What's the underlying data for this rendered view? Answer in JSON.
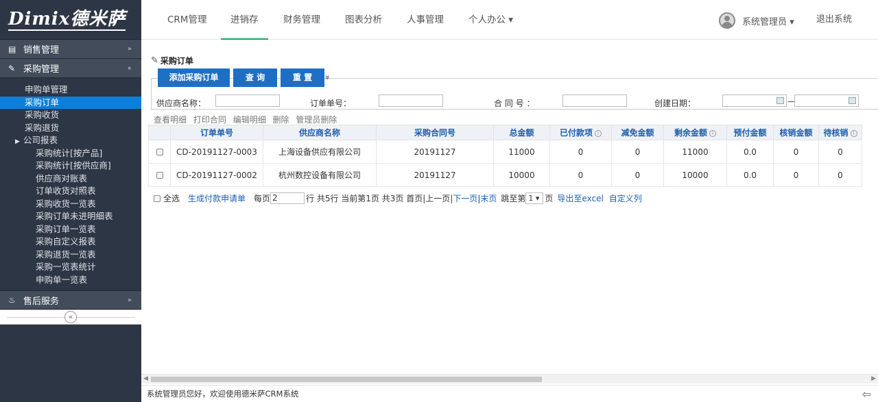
{
  "logo": "Dimix德米萨",
  "sidebar": {
    "sales": "销售管理",
    "purchase": "采购管理",
    "items": [
      "申购单管理",
      "采购订单",
      "采购收货",
      "采购退货"
    ],
    "report_group": "公司报表",
    "report_items": [
      "采购统计[按产品]",
      "采购统计[按供应商]",
      "供应商对账表",
      "订单收货对照表",
      "采购收货一览表",
      "采购订单未进明细表",
      "采购订单一览表",
      "采购自定义报表",
      "采购退货一览表",
      "采购一览表统计",
      "申购单一览表"
    ],
    "after_sales": "售后服务",
    "collapse": "«"
  },
  "topnav": {
    "items": [
      "CRM管理",
      "进销存",
      "财务管理",
      "图表分析",
      "人事管理",
      "个人办公 ▾"
    ],
    "user": "系统管理员 ▾",
    "logout": "退出系统"
  },
  "page": {
    "title": "采购订单",
    "btn_add": "添加采购订单",
    "btn_query": "查 询",
    "btn_reset": "重 置",
    "more": "»"
  },
  "search": {
    "supplier": "供应商名称：",
    "order_no": "订单单号：",
    "contract": "合 同 号 ：",
    "created": "创建日期：",
    "dash": "—"
  },
  "actions": [
    "查看明细",
    "打印合同",
    "编辑明细",
    "删除",
    "管理员删除"
  ],
  "table": {
    "headers": [
      "订单单号",
      "供应商名称",
      "采购合同号",
      "总金额",
      "已付款项",
      "减免金额",
      "剩余金额",
      "预付金额",
      "核销金额",
      "待核销"
    ],
    "rows": [
      [
        "CD-20191127-0003",
        "上海设备供应有限公司",
        "20191127",
        "11000",
        "0",
        "0",
        "11000",
        "0.0",
        "0",
        "0"
      ],
      [
        "CD-20191127-0002",
        "杭州数控设备有限公司",
        "20191127",
        "10000",
        "0",
        "0",
        "10000",
        "0.0",
        "0",
        "0"
      ]
    ]
  },
  "pager": {
    "select_all": "全选",
    "gen": "生成付款申请单",
    "per_page": "每页",
    "per_val": "2",
    "total": "行 共5行  当前第1页  共3页  首页|上一页|",
    "next": "下一页",
    "sep": "|",
    "last": "末页",
    "jump": "  跳至第",
    "jump_val": "1 ▾",
    "page_unit": "页",
    "excel": "导出至excel",
    "custom": "自定义列"
  },
  "status": "系统管理员您好，欢迎使用德米萨CRM系统"
}
